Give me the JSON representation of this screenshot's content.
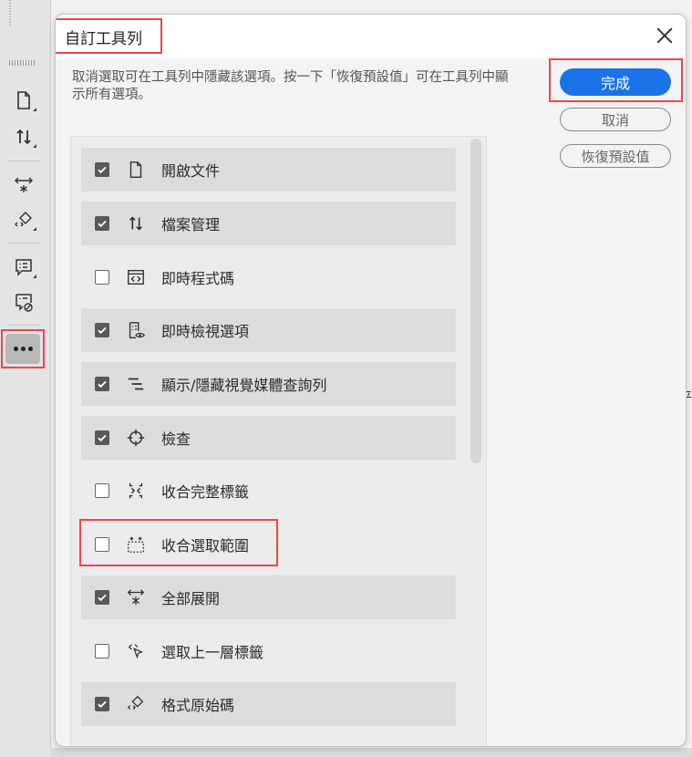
{
  "dialog": {
    "title": "自訂工具列",
    "description": "取消選取可在工具列中隱藏該選項。按一下「恢復預設值」可在工具列中顯示所有選項。",
    "buttons": {
      "done": "完成",
      "cancel": "取消",
      "restore": "恢復預設值"
    }
  },
  "toolbar_items": [
    {
      "label": "開啟文件",
      "checked": true,
      "icon": "file-icon"
    },
    {
      "label": "檔案管理",
      "checked": true,
      "icon": "file-transfer-icon"
    },
    {
      "label": "即時程式碼",
      "checked": false,
      "icon": "live-code-icon"
    },
    {
      "label": "即時檢視選項",
      "checked": true,
      "icon": "live-view-options-icon"
    },
    {
      "label": "顯示/隱藏視覺媒體查詢列",
      "checked": true,
      "icon": "media-query-bar-icon"
    },
    {
      "label": "檢查",
      "checked": true,
      "icon": "inspect-icon"
    },
    {
      "label": "收合完整標籤",
      "checked": false,
      "icon": "collapse-full-tag-icon"
    },
    {
      "label": "收合選取範圍",
      "checked": false,
      "icon": "collapse-selection-icon"
    },
    {
      "label": "全部展開",
      "checked": true,
      "icon": "expand-all-icon"
    },
    {
      "label": "選取上一層標籤",
      "checked": false,
      "icon": "select-parent-tag-icon"
    },
    {
      "label": "格式原始碼",
      "checked": true,
      "icon": "format-source-icon"
    }
  ],
  "background": {
    "right_edge_text": "平"
  },
  "colors": {
    "primary": "#1a73e8",
    "highlight": "#e8484f",
    "checkbox": "#595959"
  }
}
